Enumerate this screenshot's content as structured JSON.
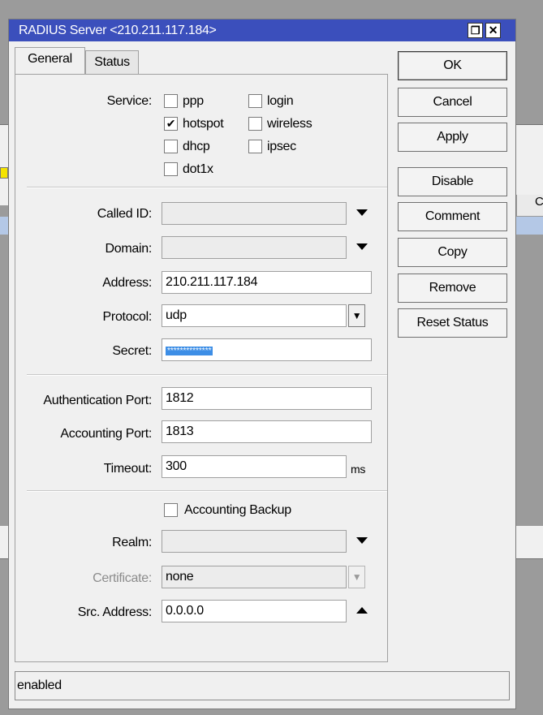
{
  "window": {
    "title": "RADIUS Server <210.211.117.184>",
    "restore_glyph": "❐",
    "close_glyph": "✕"
  },
  "tabs": [
    {
      "label": "General",
      "active": true
    },
    {
      "label": "Status",
      "active": false
    }
  ],
  "service": {
    "label": "Service:",
    "options": [
      {
        "label": "ppp",
        "checked": false
      },
      {
        "label": "login",
        "checked": false
      },
      {
        "label": "hotspot",
        "checked": true
      },
      {
        "label": "wireless",
        "checked": false
      },
      {
        "label": "dhcp",
        "checked": false
      },
      {
        "label": "ipsec",
        "checked": false
      },
      {
        "label": "dot1x",
        "checked": false
      }
    ]
  },
  "fields": {
    "called_id": {
      "label": "Called ID:",
      "value": ""
    },
    "domain": {
      "label": "Domain:",
      "value": ""
    },
    "address": {
      "label": "Address:",
      "value": "210.211.117.184"
    },
    "protocol": {
      "label": "Protocol:",
      "value": "udp"
    },
    "secret": {
      "label": "Secret:",
      "value": "**************"
    },
    "auth_port": {
      "label": "Authentication Port:",
      "value": "1812"
    },
    "acct_port": {
      "label": "Accounting Port:",
      "value": "1813"
    },
    "timeout": {
      "label": "Timeout:",
      "value": "300",
      "unit": "ms"
    },
    "accounting_backup": {
      "label": "Accounting Backup",
      "checked": false
    },
    "realm": {
      "label": "Realm:",
      "value": ""
    },
    "certificate": {
      "label": "Certificate:",
      "value": "none"
    },
    "src_address": {
      "label": "Src. Address:",
      "value": "0.0.0.0"
    }
  },
  "buttons": [
    "OK",
    "Cancel",
    "Apply",
    "Disable",
    "Comment",
    "Copy",
    "Remove",
    "Reset Status"
  ],
  "status_text": "enabled",
  "colors": {
    "titlebar": "#3b4fbc",
    "selection": "#3d8ee6"
  }
}
